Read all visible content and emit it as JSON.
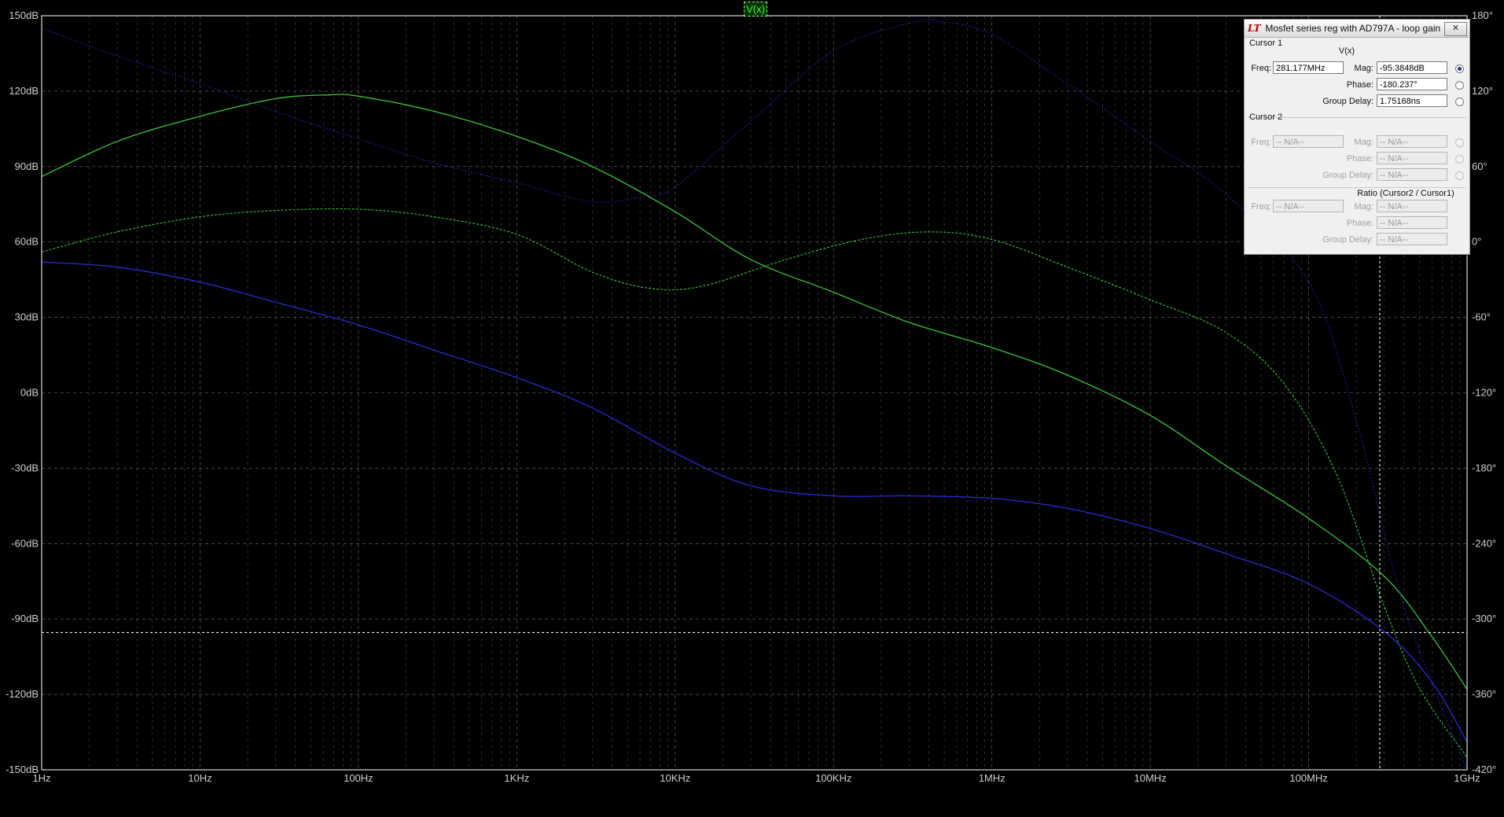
{
  "window": {
    "trace_label": "V(x)"
  },
  "chart_data": {
    "type": "line",
    "x_scale": "log",
    "xlim": [
      1,
      1000000000
    ],
    "x_ticks": [
      "1Hz",
      "10Hz",
      "100Hz",
      "1KHz",
      "10KHz",
      "100KHz",
      "1MHz",
      "10MHz",
      "100MHz",
      "1GHz"
    ],
    "y_left_ticks": [
      "150dB",
      "120dB",
      "90dB",
      "60dB",
      "30dB",
      "0dB",
      "-30dB",
      "-60dB",
      "-90dB",
      "-120dB",
      "-150dB"
    ],
    "y_left_lim": [
      -150,
      150
    ],
    "y_right_ticks": [
      "180°",
      "120°",
      "60°",
      "0°",
      "-60°",
      "-120°",
      "-180°",
      "-240°",
      "-300°",
      "-360°",
      "-420°"
    ],
    "y_right_lim": [
      -420,
      180
    ],
    "grid": true,
    "cursor": {
      "freq_hz": 281177000,
      "mag_db": -95.3848
    },
    "series": [
      {
        "axis": "mag",
        "style": "solid",
        "color": "#3cc43c",
        "x": [
          1,
          3,
          10,
          30,
          65,
          100,
          300,
          1000,
          3000,
          10000,
          30000,
          100000,
          300000,
          1000000,
          3000000,
          10000000,
          30000000,
          100000000,
          300000000,
          600000000,
          1000000000
        ],
        "y": [
          86,
          100,
          110,
          117,
          118.5,
          118,
          112,
          102,
          90,
          72,
          53,
          40,
          28,
          18,
          7,
          -9,
          -29,
          -50,
          -73,
          -97,
          -118
        ]
      },
      {
        "axis": "phase",
        "style": "dashed",
        "color": "#3cc43c",
        "x": [
          1,
          3,
          10,
          30,
          100,
          300,
          1000,
          3000,
          7000,
          15000,
          50000,
          150000,
          400000,
          1000000,
          3000000,
          10000000,
          30000000,
          70000000,
          150000000,
          300000000,
          500000000,
          1000000000
        ],
        "y": [
          -8,
          8,
          20,
          25,
          26,
          20,
          6,
          -24,
          -37,
          -35,
          -14,
          2,
          8,
          2,
          -20,
          -46,
          -72,
          -113,
          -185,
          -290,
          -355,
          -410
        ]
      },
      {
        "axis": "mag",
        "style": "solid",
        "color": "#2a2acc",
        "x": [
          1,
          3,
          10,
          30,
          100,
          300,
          1000,
          3000,
          10000,
          30000,
          100000,
          300000,
          1000000,
          3000000,
          10000000,
          30000000,
          100000000,
          300000000,
          600000000,
          1000000000
        ],
        "y": [
          52,
          50,
          44,
          36,
          27,
          17,
          6,
          -6,
          -24,
          -37,
          -41,
          -41,
          -42,
          -46,
          -54,
          -64,
          -76,
          -95,
          -115,
          -139
        ]
      },
      {
        "axis": "phase",
        "style": "dotted",
        "color": "#2a2acc",
        "x": [
          1,
          3,
          10,
          30,
          100,
          300,
          1000,
          3000,
          6000,
          10000,
          30000,
          100000,
          300000,
          500000,
          1000000,
          3000000,
          10000000,
          30000000,
          100000000,
          200000000,
          400000000,
          1000000000
        ],
        "y": [
          170,
          148,
          126,
          104,
          82,
          63,
          47,
          32,
          36,
          44,
          96,
          152,
          174,
          175,
          165,
          126,
          80,
          38,
          -32,
          -142,
          -290,
          -420
        ]
      }
    ]
  },
  "cursor_dialog": {
    "title": "Mosfet series reg with AD797A - loop gain",
    "logo": "LT",
    "close_label": "✕",
    "cursor1": {
      "header": "Cursor 1",
      "trace": "V(x)",
      "freq_label": "Freq:",
      "freq_value": "281.177MHz",
      "mag_label": "Mag:",
      "mag_value": "-95.3848dB",
      "phase_label": "Phase:",
      "phase_value": "-180.237°",
      "gd_label": "Group Delay:",
      "gd_value": "1.75168ns"
    },
    "cursor2": {
      "header": "Cursor 2",
      "freq_label": "Freq:",
      "freq_value": "-- N/A--",
      "mag_label": "Mag:",
      "mag_value": "-- N/A--",
      "phase_label": "Phase:",
      "phase_value": "-- N/A--",
      "gd_label": "Group Delay:",
      "gd_value": "-- N/A--"
    },
    "ratio": {
      "header": "Ratio (Cursor2 / Cursor1)",
      "freq_label": "Freq:",
      "freq_value": "-- N/A--",
      "mag_label": "Mag:",
      "mag_value": "-- N/A--",
      "phase_label": "Phase:",
      "phase_value": "-- N/A--",
      "gd_label": "Group Delay:",
      "gd_value": "-- N/A--"
    }
  }
}
